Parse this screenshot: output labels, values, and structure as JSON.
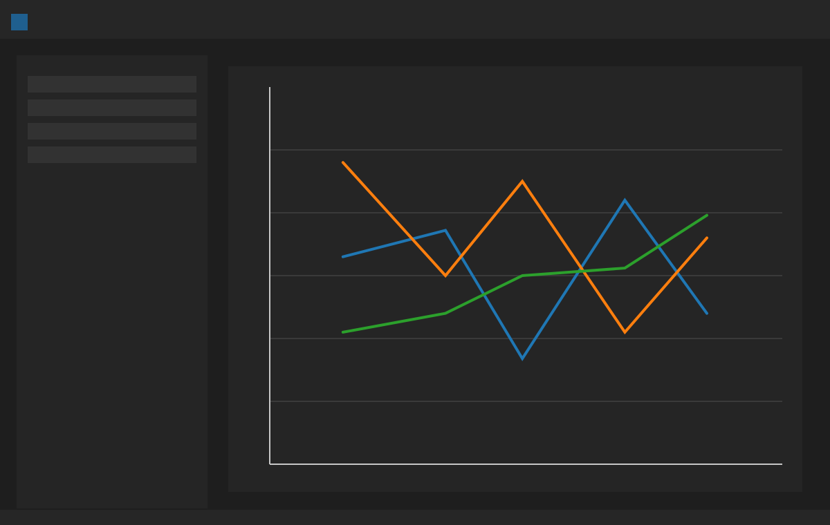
{
  "theme": {
    "accent": "#1f5f8f",
    "background": "#1e1e1e",
    "panel": "#252525",
    "sidebar_item": "#323232",
    "gridline": "#3a3a3a",
    "axis": "#c8c8c8"
  },
  "titlebar": {
    "icon": "app-square-icon"
  },
  "sidebar": {
    "items": [
      {
        "label": ""
      },
      {
        "label": ""
      },
      {
        "label": ""
      },
      {
        "label": ""
      }
    ]
  },
  "chart_data": {
    "type": "line",
    "title": "",
    "xlabel": "",
    "ylabel": "",
    "x": [
      1,
      2.4,
      3.45,
      4.85,
      5.97
    ],
    "xlim": [
      0,
      7
    ],
    "ylim": [
      0,
      6
    ],
    "grid": true,
    "legend": "none",
    "series": [
      {
        "color": "#1f77b4",
        "values": [
          3.3,
          3.72,
          1.68,
          4.2,
          2.4
        ]
      },
      {
        "color": "#ff7f0e",
        "values": [
          4.8,
          3.0,
          4.5,
          2.1,
          3.6
        ]
      },
      {
        "color": "#2ca02c",
        "values": [
          2.1,
          2.4,
          3.0,
          3.12,
          3.96
        ]
      }
    ]
  }
}
